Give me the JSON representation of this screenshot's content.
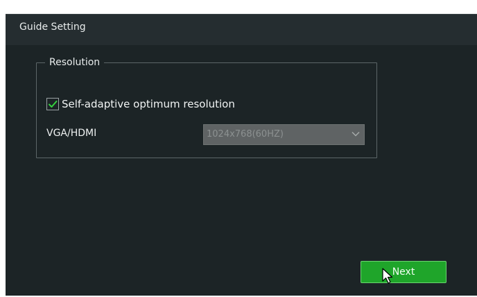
{
  "window": {
    "title": "Guide Setting"
  },
  "resolution_group": {
    "legend": "Resolution",
    "self_adaptive": {
      "label": "Self-adaptive optimum resolution",
      "checked": true
    },
    "vga_hdmi": {
      "label": "VGA/HDMI",
      "selected_value": "1024x768(60HZ)",
      "disabled": true
    }
  },
  "footer": {
    "next_label": "Next"
  },
  "colors": {
    "background": "#1c2426",
    "accent_green": "#1fa52a"
  },
  "icons": {
    "checkbox": "check-icon",
    "dropdown": "chevron-down-icon",
    "cursor": "mouse-pointer-icon"
  }
}
